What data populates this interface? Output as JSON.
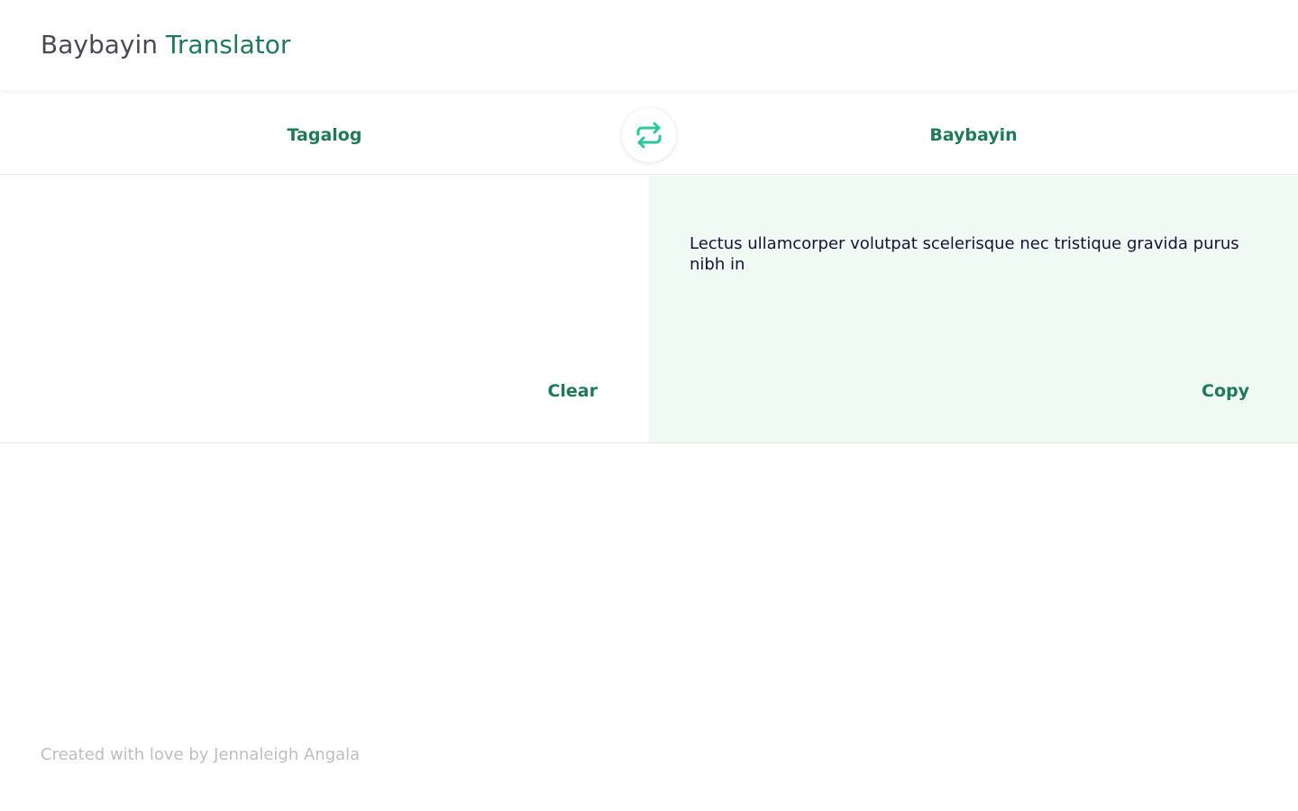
{
  "app": {
    "title_primary": "Baybayin",
    "title_accent": "Translator"
  },
  "languages": {
    "source": "Tagalog",
    "target": "Baybayin",
    "swap_icon": "swap-arrows-icon"
  },
  "input_panel": {
    "value": "",
    "placeholder": "",
    "clear_label": "Clear"
  },
  "output_panel": {
    "text": "Lectus ullamcorper volutpat scelerisque nec tristique gravida purus nibh in",
    "copy_label": "Copy"
  },
  "footer": {
    "text": "Created with love by Jennaleigh Angala"
  },
  "colors": {
    "accent": "#1e7a57",
    "swap_icon": "#2ec79a",
    "output_background": "#effaf4",
    "title_dark": "#4a4a57",
    "footer_text": "#bdbdc3"
  }
}
